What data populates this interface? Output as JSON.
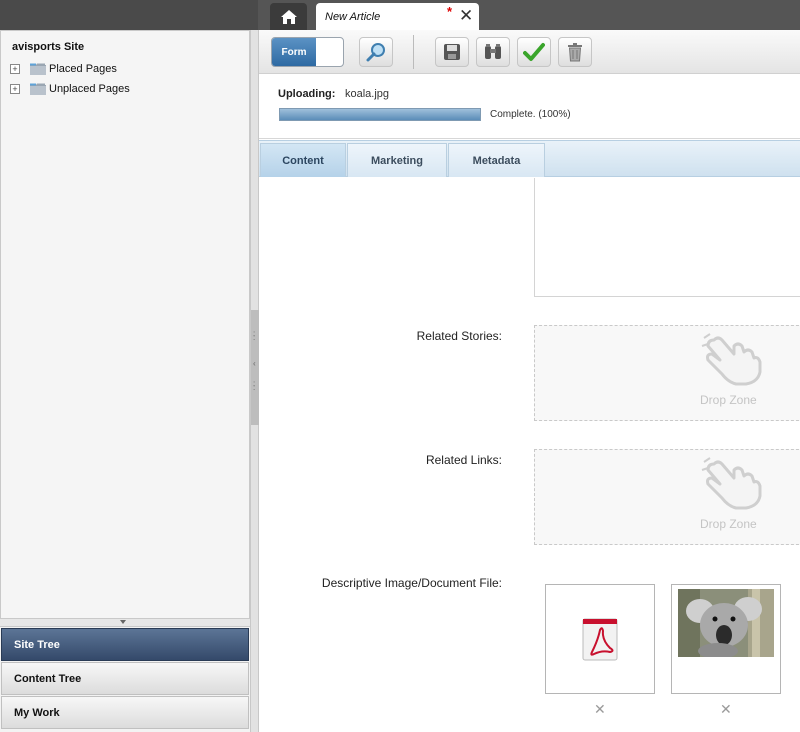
{
  "tabs": {
    "home_icon": "home-icon",
    "document_title": "New Article",
    "modified_marker": "*",
    "close_symbol": "✕"
  },
  "site_tree": {
    "title": "avisports Site",
    "items": [
      {
        "label": "Placed Pages",
        "expand": "+"
      },
      {
        "label": "Unplaced Pages",
        "expand": "+"
      }
    ]
  },
  "nav": {
    "items": [
      {
        "label": "Site Tree",
        "active": true
      },
      {
        "label": "Content Tree",
        "active": false
      },
      {
        "label": "My Work",
        "active": false
      }
    ]
  },
  "toolbar": {
    "form_label": "Form",
    "buttons": [
      "preview-icon",
      "save-icon",
      "find-icon",
      "approve-icon",
      "delete-icon"
    ]
  },
  "upload": {
    "label": "Uploading:",
    "filename": "koala.jpg",
    "progress": 1.0,
    "status": "Complete. (100%)"
  },
  "subtabs": [
    {
      "label": "Content",
      "active": true
    },
    {
      "label": "Marketing",
      "active": false
    },
    {
      "label": "Metadata",
      "active": false
    }
  ],
  "form": {
    "related_stories_label": "Related Stories:",
    "related_links_label": "Related Links:",
    "descriptive_image_label": "Descriptive Image/Document File:",
    "drop_zone_text": "Drop Zone",
    "remove_symbol": "✕"
  },
  "colors": {
    "nav_active": "#3f5778",
    "progress_fill": "#5b8db8",
    "pdf_red": "#c8102e",
    "approve_green": "#3aa52b"
  }
}
